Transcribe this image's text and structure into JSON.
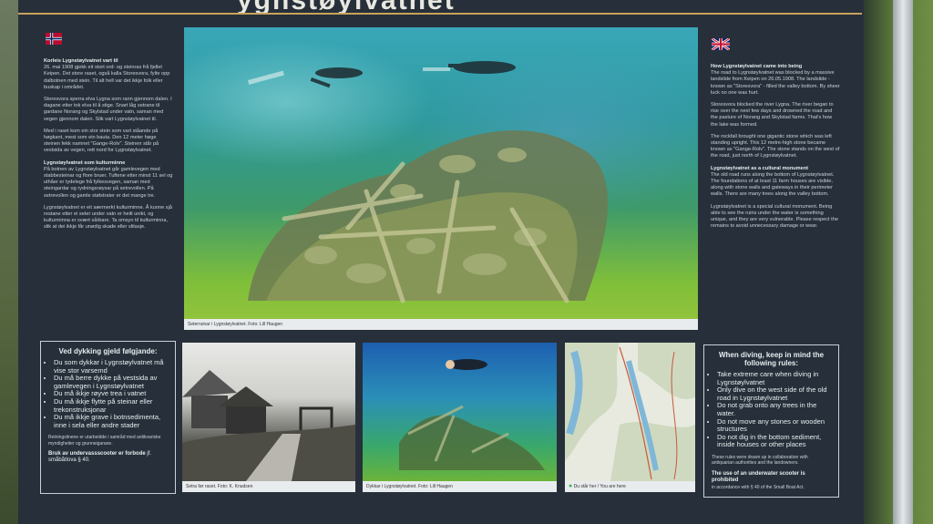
{
  "sign": {
    "title": "ygnstøylvatnet"
  },
  "norwegian": {
    "heading1": "Korleis Lygnstøylvatnet vart til",
    "para1": "26. mai 1908 gjekk eit stort ord- og steinras frå fjellet Keipen. Det store raset, også kalla Storesvora, fylte opp dalbotnen med stein. Til alt hell var det ikkje folk eller buskap i området.",
    "para2": "Storesvora sperra elva Lygna som rann gjennom dalen. I dagane etter tok elva til å stige. Snart låg setrane til gardane Norang og Skylstad under vatn, saman med vegen gjennom dalen. Slik vart Lygnstøylvatnet til.",
    "para3": "Med i raset kom ein stor stein som vart ståande på høgkant, mest som ein bauta. Den 12 meter høge steinen fekk namnet \"Gange-Rolv\". Steinen står på vestsida av vegen, rett nord for Lygnstøylvatnet.",
    "heading2": "Lygnstøylvatnet som kulturminne",
    "para4": "På botnen av Lygnstøylvatnet går gamlevegen med stabbesteinar og flore bruer. Tuftene etter minst 11 sel og uthåer er tydelege frå fylkesvegen, saman med steingardar og rydningsrøysar på setrevollen. På setrevollen og gamle stølstrater er det mange tre.",
    "para5": "Lygnstøylvatnet er eit særmerkt kulturminne. Å kunne sjå restane etter ei seter under vatn er heilt unikt, og kulturminna er svært sårbare. Ta omsyn til kulturminna, slik at dei ikkje får unødig skade eller slitasje."
  },
  "english": {
    "heading1": "How Lygnstøylvatnet came into being",
    "para1": "The road to Lygnstøylvatnet was blocked by a massive landslide from Keipen on 26.05.1908. The landslide - known as \"Storesvora\" - filled the valley bottom. By sheer luck no one was hurt.",
    "para2": "Storesvora blocked the river Lygna. The river began to rise over the next few days and drowned the road and the pasture of Norang and Skylstad farms. That's how the lake was formed.",
    "para3": "The rockfall brought one gigantic stone which was left standing upright. This 12 metre-high stone became known as \"Gange-Rolv\". The stone stands on the west of the road, just north of Lygnstøylvatnet.",
    "heading2": "Lygnstøylvatnet as a cultural monument",
    "para4": "The old road runs along the bottom of Lygnstøylvatnet. The foundations of at least 11 farm houses are visible, along with stone walls and gateways in their perimeter walls. There are many trees along the valley bottom.",
    "para5": "Lygnstøylvatnet is a special cultural monument. Being able to see the ruins under the water is something unique, and they are very vulnerable. Please respect the remains to avoid unnecessary damage or wear."
  },
  "main_photo": {
    "caption": "Seterruinar i Lygnstøylvatnet. Foto: Lill Haugen"
  },
  "rules_no": {
    "heading": "Ved dykking gjeld følgjande:",
    "items": [
      "Du som dykkar i Lygnstøylvatnet må vise stor varsemd",
      "Du må berre dykke på vestsida av gamlevegen i Lygnstøylvatnet",
      "Du må ikkje røyve trea i vatnet",
      "Du må ikkje flytte på steinar eller trekonstruksjonar",
      "Du må ikkje grave i botnsedimenta, inne i sela eller andre stader"
    ],
    "note": "Retningslinene er utarbeidde i samråd med antikvariske myndigheiter og grunneigarane.",
    "scooter": "Bruk av undervassscooter er forbode",
    "scooter_ref": "jf. småbåtlova § 40."
  },
  "rules_en": {
    "heading": "When diving, keep in mind the following rules:",
    "items": [
      "Take extreme care when diving in Lygnstøylvatnet",
      "Only dive on the west side of the old road in Lygnstøylvatnet",
      "Do not grab onto any trees in the water.",
      "Do not move any stones or wooden structures",
      "Do not dig in the bottom sediment, inside houses or other places"
    ],
    "note": "These rules were drawn up in collaboration with antiquarian authorities and the landowners.",
    "scooter": "The use of an underwater scooter is prohibited",
    "scooter_ref": "in accordance with § 40 of the Small Boat Act."
  },
  "thumbs": {
    "seter_caption": "Setra før raset. Foto: K. Knudsen",
    "diver_caption": "Dykkar i Lygnstøylvatnet. Foto: Lill Haugen",
    "map_caption": "Du står her / You are here"
  },
  "colors": {
    "board": "#27303a",
    "accent_rule": "#c6a35a",
    "you_are_here": "#3db34a"
  }
}
